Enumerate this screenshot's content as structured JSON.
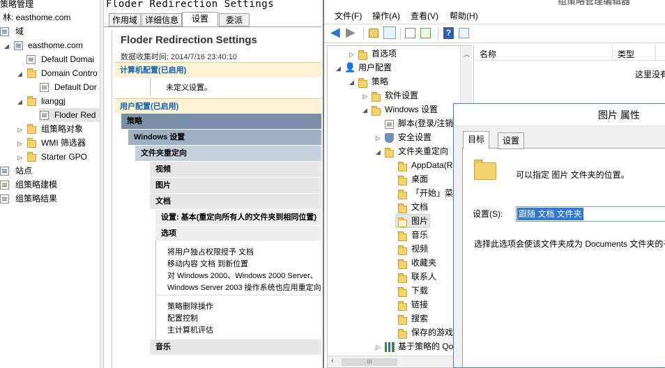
{
  "left_tree": {
    "title": "策略管理",
    "forest": "林: easthome.com",
    "domains": "域",
    "domain": "easthome.com",
    "default_domain": "Default Domai",
    "domain_controllers": "Domain Contro",
    "default_dc": "Default Dor",
    "lianggj": "lianggj",
    "floder_redirect": "Floder Red",
    "gpo_objects": "组策略对象",
    "wmi": "WMI 筛选器",
    "starter": "Starter GPO",
    "sites": "站点",
    "modeling": "组策略建模",
    "results": "组策略结果"
  },
  "report": {
    "header_title": "Floder Redirection Settings",
    "tabs": [
      "作用域",
      "详细信息",
      "设置",
      "委派"
    ],
    "title": "Floder Redirection Settings",
    "collected": "数据收集时间: 2014/7/16 23:40:10",
    "computer_config": "计算机配置(已启用)",
    "undefined": "未定义设置。",
    "user_config": "用户配置(已启用)",
    "policy": "策略",
    "windows_settings": "Windows 设置",
    "folder_redirect": "文件夹重定向",
    "videos": "视频",
    "pictures": "图片",
    "documents": "文档",
    "setting_line": "设置: 基本(重定向所有人的文件夹到相同位置)",
    "options": "选项",
    "opt1": "将用户独占权限授予 文档",
    "opt2": "移动内容 文档 到新位置",
    "opt3": "对 Windows 2000、Windows 2000 Server、",
    "opt4": "Windows Server 2003 操作系统也应用重定向",
    "rm1": "策略删除操作",
    "rm2": "配置控制",
    "rm3": "主计算机评估",
    "music": "音乐"
  },
  "editor": {
    "title": "组策略管理编辑器",
    "menus": [
      "文件(F)",
      "操作(A)",
      "查看(V)",
      "帮助(H)"
    ],
    "tree": {
      "prefs": "首选项",
      "user_config": "用户配置",
      "policy": "策略",
      "software": "软件设置",
      "windows": "Windows 设置",
      "scripts": "脚本(登录/注销",
      "security": "安全设置",
      "folder_redirect": "文件夹重定向",
      "appdata": "AppData(R",
      "desktop": "桌面",
      "start": "「开始」菜",
      "documents": "文档",
      "pictures": "图片",
      "music": "音乐",
      "videos": "视频",
      "favorites": "收藏夹",
      "contacts": "联系人",
      "downloads": "下载",
      "links": "链接",
      "searches": "搜索",
      "saved_games": "保存的游戏",
      "qos": "基于策略的 Qo"
    },
    "list_header_name": "名称",
    "list_header_type": "类型",
    "list_empty": "这里没有"
  },
  "dialog": {
    "title": "图片 属性",
    "tabs": [
      "目标",
      "设置"
    ],
    "desc": "可以指定 图片 文件夹的位置。",
    "setting_label": "设置(S):",
    "setting_value": "跟随 文档 文件夹",
    "help": "选择此选项会使该文件夹成为 Documents 文件夹的子"
  }
}
